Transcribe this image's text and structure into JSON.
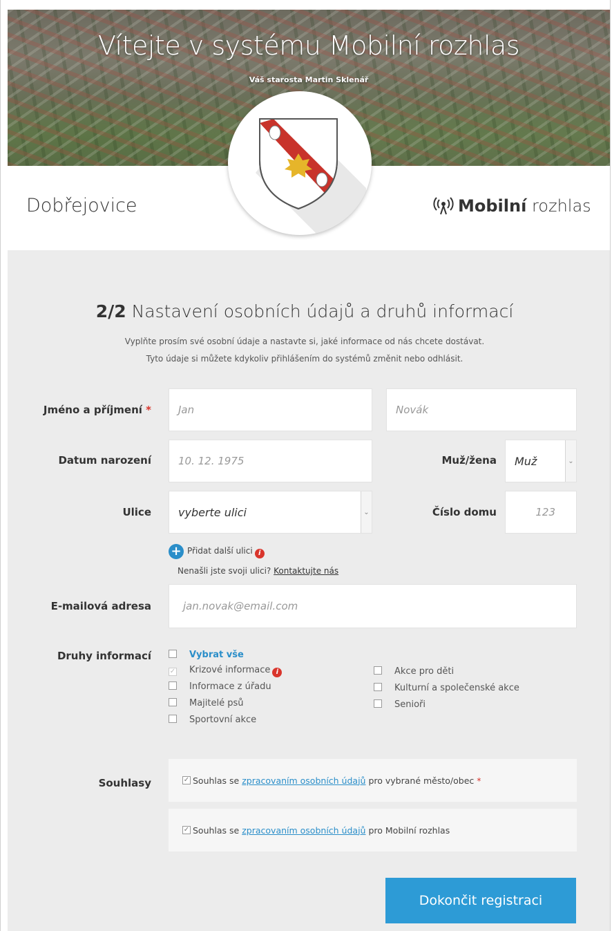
{
  "hero": {
    "title": "Vítejte v systému Mobilní rozhlas",
    "subtitle": "Váš starosta Martin Sklenář"
  },
  "header": {
    "town": "Dobřejovice",
    "brand_bold": "Mobilní",
    "brand_light": "rozhlas"
  },
  "form": {
    "step": "2/2",
    "heading": "Nastavení osobních údajů a druhů informací",
    "intro_line1": "Vyplňte prosím své osobní údaje a nastavte si, jaké informace od nás chcete dostávat.",
    "intro_line2": "Tyto údaje si můžete kdykoliv přihlášením do systémů změnit nebo odhlásit.",
    "name_label": "Jméno a příjmení",
    "required_mark": "*",
    "first_name_placeholder": "Jan",
    "last_name_placeholder": "Novák",
    "birth_label": "Datum narození",
    "birth_placeholder": "10. 12. 1975",
    "gender_label": "Muž/žena",
    "gender_value": "Muž",
    "street_label": "Ulice",
    "street_value": "vyberte ulici",
    "house_label": "Číslo domu",
    "house_placeholder": "123",
    "add_street": "Přidat další ulici",
    "not_found_text": "Nenašli jste svoji ulici?",
    "contact_link": "Kontaktujte nás",
    "email_label": "E-mailová adresa",
    "email_placeholder": "jan.novak@email.com",
    "info_types_label": "Druhy informací",
    "select_all": "Vybrat vše",
    "info_types_left": [
      "Krizové informace",
      "Informace z úřadu",
      "Majitelé psů",
      "Sportovní akce"
    ],
    "info_types_right": [
      "Akce pro děti",
      "Kulturní a společenské akce",
      "Senioři"
    ],
    "consents_label": "Souhlasy",
    "consent1_pre": "Souhlas se",
    "consent1_link": "zpracovaním osobních údajů",
    "consent1_post": "pro vybrané město/obec",
    "consent2_pre": "Souhlas se",
    "consent2_link": "zpracovaním osobních údajů",
    "consent2_post": "pro Mobilní rozhlas",
    "submit_label": "Dokončit registraci"
  },
  "colors": {
    "accent": "#2d9bd6",
    "required": "#d9352c",
    "shield_red": "#c8332b",
    "leaf_gold": "#e6b52a"
  }
}
